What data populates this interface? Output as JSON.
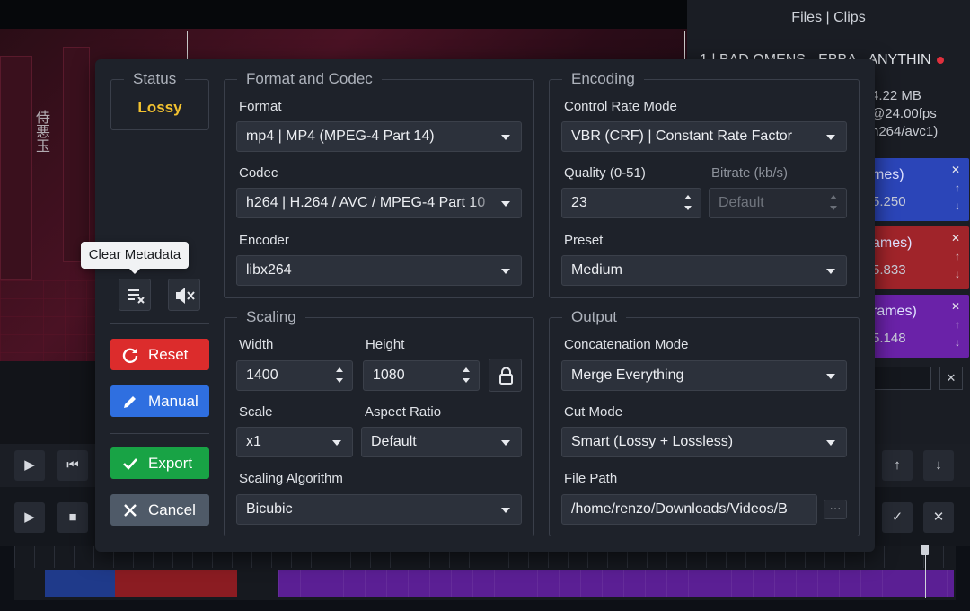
{
  "background": {
    "preview_vertical_text": "侍悪玉",
    "panel_title": "Files | Clips",
    "file_row": "1 | BAD OMENS - EBBA - ANYTHIN",
    "file_info": [
      "4.22 MB",
      "@24.00fps",
      "h264/avc1)"
    ],
    "clips": [
      {
        "title": "mes)",
        "value": "5.250",
        "color": "#2b45b8"
      },
      {
        "title": "ames)",
        "value": "5.833",
        "color": "#a0242a"
      },
      {
        "title": "rames)",
        "value": "5.148",
        "color": "#6a22a8"
      }
    ]
  },
  "dialog": {
    "status": {
      "legend": "Status",
      "value": "Lossy"
    },
    "tooltip": "Clear Metadata",
    "icons": {
      "clear_metadata": "clear-metadata-icon",
      "mute": "volume-mute-icon"
    },
    "buttons": {
      "reset": "Reset",
      "manual": "Manual",
      "export": "Export",
      "cancel": "Cancel"
    },
    "format_codec": {
      "legend": "Format and Codec",
      "format_label": "Format",
      "format_value": "mp4 | MP4 (MPEG-4 Part 14)",
      "codec_label": "Codec",
      "codec_value": "h264 | H.264 / AVC / MPEG-4 Part 10",
      "encoder_label": "Encoder",
      "encoder_value": "libx264"
    },
    "encoding": {
      "legend": "Encoding",
      "control_rate_label": "Control Rate Mode",
      "control_rate_value": "VBR (CRF) | Constant Rate Factor",
      "quality_label": "Quality (0-51)",
      "quality_value": "23",
      "bitrate_label": "Bitrate (kb/s)",
      "bitrate_placeholder": "Default",
      "preset_label": "Preset",
      "preset_value": "Medium"
    },
    "scaling": {
      "legend": "Scaling",
      "width_label": "Width",
      "width_value": "1400",
      "height_label": "Height",
      "height_value": "1080",
      "scale_label": "Scale",
      "scale_value": "x1",
      "aspect_label": "Aspect Ratio",
      "aspect_value": "Default",
      "algorithm_label": "Scaling Algorithm",
      "algorithm_value": "Bicubic"
    },
    "output": {
      "legend": "Output",
      "concat_label": "Concatenation Mode",
      "concat_value": "Merge Everything",
      "cut_label": "Cut Mode",
      "cut_value": "Smart (Lossy + Lossless)",
      "path_label": "File Path",
      "path_value": "/home/renzo/Downloads/Videos/B",
      "more_label": "···"
    }
  }
}
